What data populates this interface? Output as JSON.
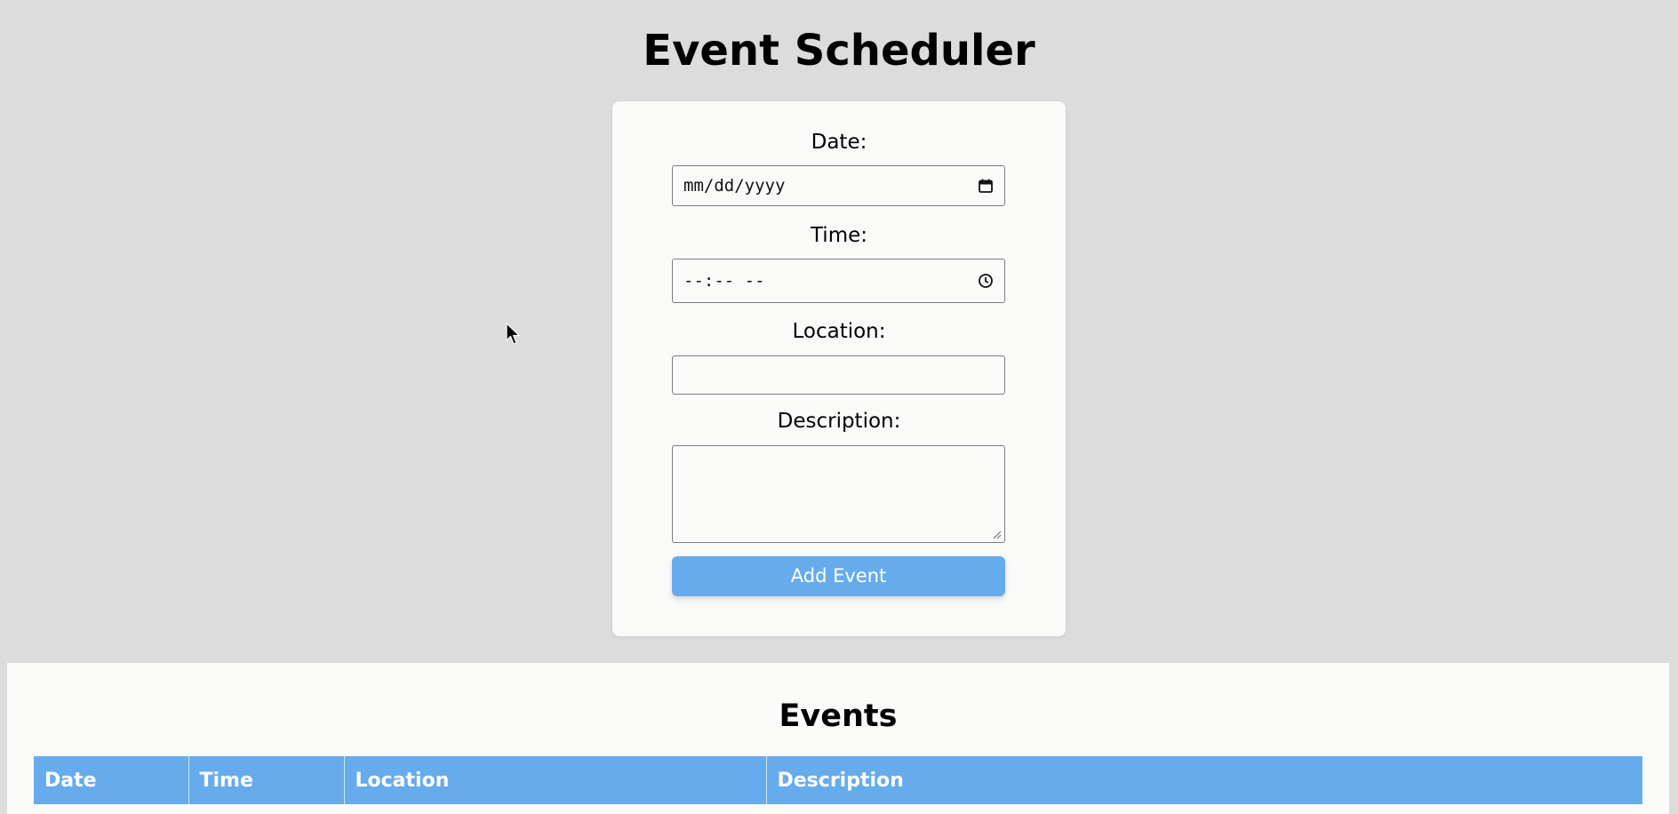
{
  "page": {
    "title": "Event Scheduler"
  },
  "form": {
    "date_label": "Date:",
    "date_value": "mm/dd/yyyy",
    "time_label": "Time:",
    "time_value": "--:-- --",
    "location_label": "Location:",
    "location_value": "",
    "description_label": "Description:",
    "description_value": "",
    "submit_label": "Add Event"
  },
  "events": {
    "title": "Events",
    "columns": [
      "Date",
      "Time",
      "Location",
      "Description"
    ],
    "rows": []
  },
  "colors": {
    "accent": "#66aced",
    "page_background": "#dcdcdc",
    "card_background": "#fafaf9"
  },
  "icons": {
    "date_picker": "calendar-icon",
    "time_picker": "clock-icon",
    "textarea_resize": "resize-handle-icon",
    "pointer": "mouse-cursor-icon"
  }
}
